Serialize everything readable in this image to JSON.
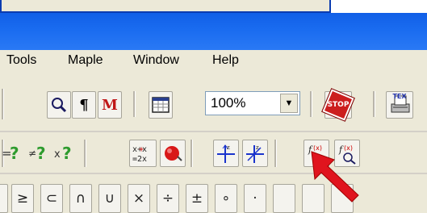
{
  "menubar": {
    "items": [
      "Tools",
      "Maple",
      "Window",
      "Help"
    ]
  },
  "toolbar1": {
    "zoom_value": "100%",
    "stop_label": "STOP",
    "tex_label": "TEX",
    "maple_m": "M"
  },
  "toolbar2": {
    "eval_label": "x+x\n=2x"
  },
  "palette": {
    "symbols": [
      "≥",
      "⊂",
      "∩",
      "∪",
      "×",
      "÷",
      "±",
      "∘",
      "·"
    ]
  },
  "colors": {
    "title_bar": "#1a6cf0",
    "stop_red": "#cc1e1e",
    "annotation_arrow": "#e0141e"
  }
}
